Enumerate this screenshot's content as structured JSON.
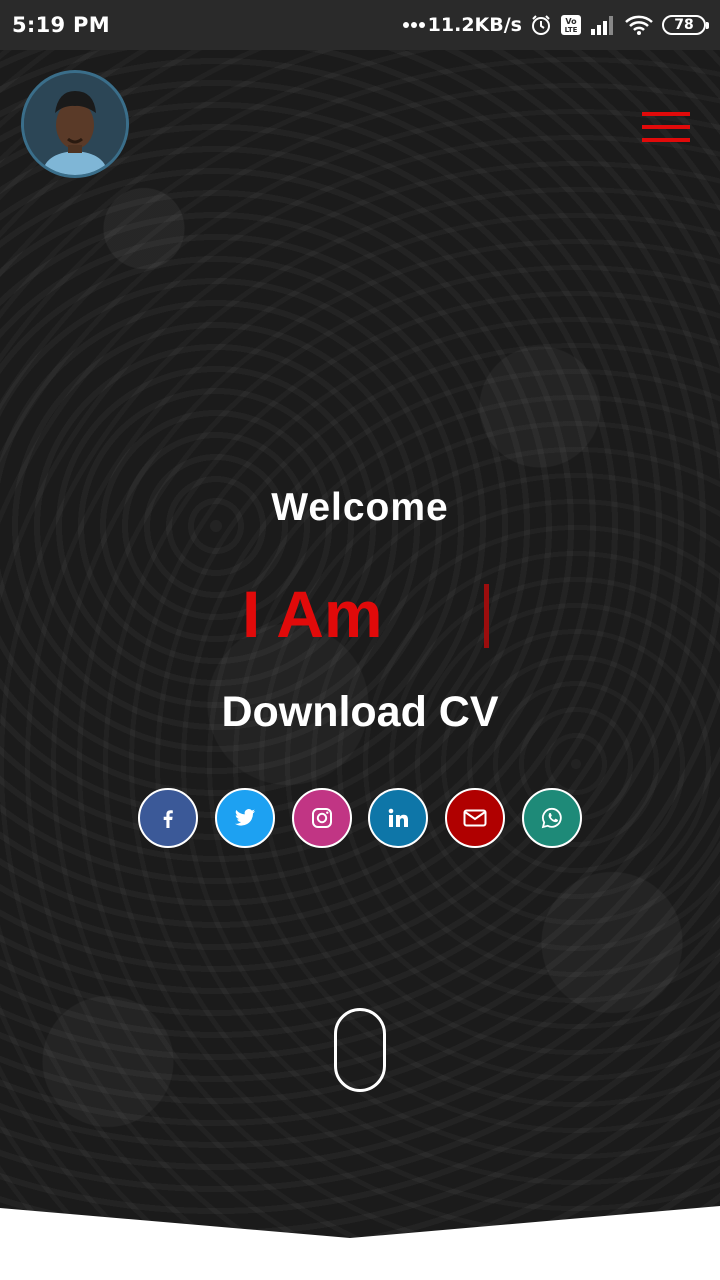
{
  "status_bar": {
    "time": "5:19 PM",
    "network_speed": "11.2KB/s",
    "battery": "78",
    "icons": [
      "dots-icon",
      "alarm-icon",
      "volte-icon",
      "signal-icon",
      "wifi-icon",
      "battery-icon"
    ]
  },
  "header": {
    "avatar_icon": "profile-photo",
    "menu_icon": "hamburger-menu-icon",
    "accent_color": "#e10a0a"
  },
  "hero": {
    "welcome": "Welcome",
    "iam": "I Am",
    "download_cv": "Download CV",
    "scroll_icon": "scroll-mouse-icon"
  },
  "social": [
    {
      "name": "facebook",
      "icon": "facebook-icon",
      "color": "#3b5998"
    },
    {
      "name": "twitter",
      "icon": "twitter-icon",
      "color": "#1da1f2"
    },
    {
      "name": "instagram",
      "icon": "instagram-icon",
      "color": "#c13584"
    },
    {
      "name": "linkedin",
      "icon": "linkedin-icon",
      "color": "#0e76a8"
    },
    {
      "name": "email",
      "icon": "mail-icon",
      "color": "#b00000"
    },
    {
      "name": "whatsapp",
      "icon": "whatsapp-icon",
      "color": "#1e8a78"
    }
  ]
}
